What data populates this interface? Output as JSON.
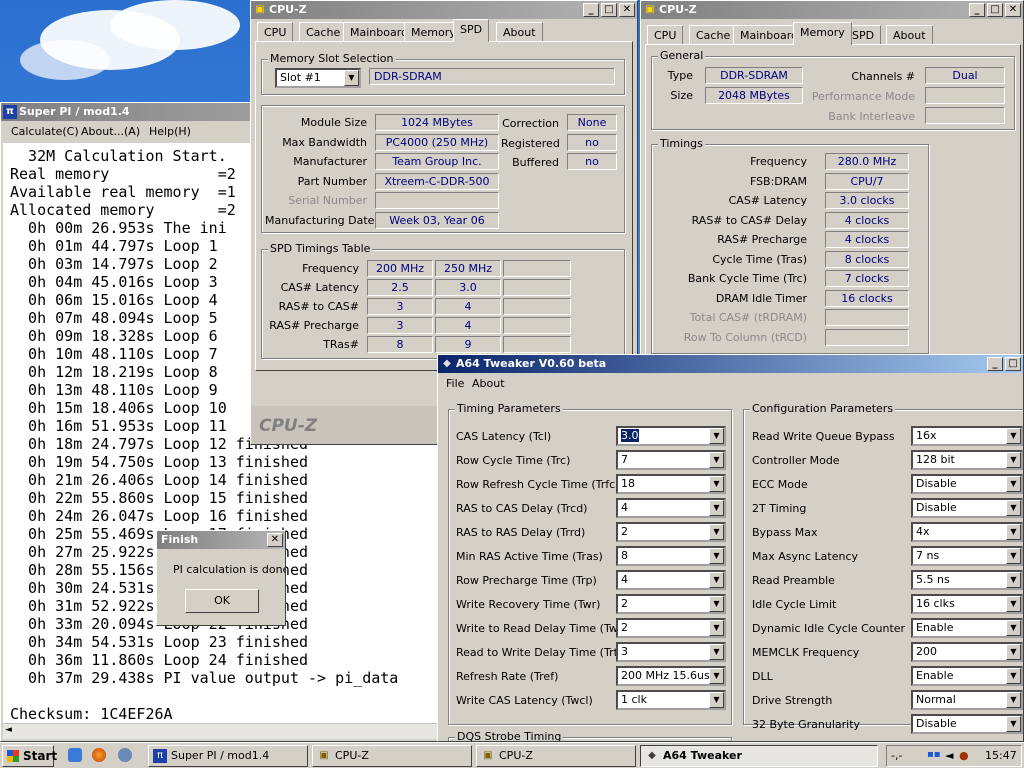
{
  "superpi": {
    "title": "Super PI / mod1.4",
    "menu": [
      "Calculate(C)",
      "About...(A)",
      "Help(H)"
    ],
    "lines": [
      "  32M Calculation Start.",
      "Real memory            =2",
      "Available real memory  =1",
      "Allocated memory       =2",
      "  0h 00m 26.953s The ini",
      "  0h 01m 44.797s Loop 1",
      "  0h 03m 14.797s Loop 2",
      "  0h 04m 45.016s Loop 3",
      "  0h 06m 15.016s Loop 4",
      "  0h 07m 48.094s Loop 5",
      "  0h 09m 18.328s Loop 6",
      "  0h 10m 48.110s Loop 7",
      "  0h 12m 18.219s Loop 8",
      "  0h 13m 48.110s Loop 9",
      "  0h 15m 18.406s Loop 10",
      "  0h 16m 51.953s Loop 11",
      "  0h 18m 24.797s Loop 12 finished",
      "  0h 19m 54.750s Loop 13 finished",
      "  0h 21m 26.406s Loop 14 finished",
      "  0h 22m 55.860s Loop 15 finished",
      "  0h 24m 26.047s Loop 16 finished",
      "  0h 25m 55.469s Loop 17 finished",
      "  0h 27m 25.922s Loop 18 finished",
      "  0h 28m 55.156s Loop 19 finished",
      "  0h 30m 24.531s Loop 20 finished",
      "  0h 31m 52.922s Loop 21 finished",
      "  0h 33m 20.094s Loop 22 finished",
      "  0h 34m 54.531s Loop 23 finished",
      "  0h 36m 11.860s Loop 24 finished",
      "  0h 37m 29.438s PI value output -> pi_data",
      "",
      "Checksum: 1C4EF26A"
    ]
  },
  "finish": {
    "title": "Finish",
    "message": "PI calculation is done!",
    "ok": "OK"
  },
  "cpuz_spd": {
    "title": "CPU-Z",
    "tabs": [
      "CPU",
      "Cache",
      "Mainboard",
      "Memory",
      "SPD",
      "About"
    ],
    "slot_group": "Memory Slot Selection",
    "slot": "Slot #1",
    "slot_type": "DDR-SDRAM",
    "rows": [
      {
        "label": "Module Size",
        "value": "1024 MBytes"
      },
      {
        "label": "Max Bandwidth",
        "value": "PC4000 (250 MHz)"
      },
      {
        "label": "Manufacturer",
        "value": "Team Group Inc."
      },
      {
        "label": "Part Number",
        "value": "Xtreem-C-DDR-500"
      },
      {
        "label": "Serial Number",
        "value": ""
      },
      {
        "label": "Manufacturing Date",
        "value": "Week 03, Year 06"
      }
    ],
    "side": [
      {
        "label": "Correction",
        "value": "None"
      },
      {
        "label": "Registered",
        "value": "no"
      },
      {
        "label": "Buffered",
        "value": "no"
      }
    ],
    "timings_group": "SPD Timings Table",
    "timing_rows": [
      {
        "label": "Frequency",
        "v1": "200 MHz",
        "v2": "250 MHz"
      },
      {
        "label": "CAS# Latency",
        "v1": "2.5",
        "v2": "3.0"
      },
      {
        "label": "RAS# to CAS#",
        "v1": "3",
        "v2": "4"
      },
      {
        "label": "RAS# Precharge",
        "v1": "3",
        "v2": "4"
      },
      {
        "label": "TRas#",
        "v1": "8",
        "v2": "9"
      }
    ],
    "brand": "CPU-Z"
  },
  "cpuz_mem": {
    "title": "CPU-Z",
    "tabs": [
      "CPU",
      "Cache",
      "Mainboard",
      "Memory",
      "SPD",
      "About"
    ],
    "general": "General",
    "type_label": "Type",
    "type": "DDR-SDRAM",
    "size_label": "Size",
    "size": "2048 MBytes",
    "channels_label": "Channels #",
    "channels": "Dual",
    "perf_label": "Performance Mode",
    "bank_label": "Bank Interleave",
    "timings": "Timings",
    "rows": [
      {
        "label": "Frequency",
        "value": "280.0 MHz"
      },
      {
        "label": "FSB:DRAM",
        "value": "CPU/7"
      },
      {
        "label": "CAS# Latency",
        "value": "3.0 clocks"
      },
      {
        "label": "RAS# to CAS# Delay",
        "value": "4 clocks"
      },
      {
        "label": "RAS# Precharge",
        "value": "4 clocks"
      },
      {
        "label": "Cycle Time (Tras)",
        "value": "8 clocks"
      },
      {
        "label": "Bank Cycle Time (Trc)",
        "value": "7 clocks"
      },
      {
        "label": "DRAM Idle Timer",
        "value": "16 clocks"
      },
      {
        "label": "Total CAS# (tRDRAM)",
        "value": ""
      },
      {
        "label": "Row To Column (tRCD)",
        "value": ""
      }
    ]
  },
  "a64": {
    "title": "A64 Tweaker V0.60 beta",
    "menu": [
      "File",
      "About"
    ],
    "timing_group": "Timing Parameters",
    "config_group": "Configuration Parameters",
    "dqs_group": "DQS Strobe Timing",
    "timing": [
      {
        "label": "CAS Latency (Tcl)",
        "value": "3.0"
      },
      {
        "label": "Row Cycle Time (Trc)",
        "value": "7"
      },
      {
        "label": "Row Refresh Cycle Time (Trfc)",
        "value": "18"
      },
      {
        "label": "RAS to CAS Delay (Trcd)",
        "value": "4"
      },
      {
        "label": "RAS to RAS Delay (Trrd)",
        "value": "2"
      },
      {
        "label": "Min RAS Active Time (Tras)",
        "value": "8"
      },
      {
        "label": "Row Precharge Time (Trp)",
        "value": "4"
      },
      {
        "label": "Write Recovery Time (Twr)",
        "value": "2"
      },
      {
        "label": "Write to Read Delay Time (Twtr)",
        "value": "2"
      },
      {
        "label": "Read to Write Delay Time (Trtw)",
        "value": "3"
      },
      {
        "label": "Refresh Rate (Tref)",
        "value": "200 MHz 15.6us"
      },
      {
        "label": "Write CAS Latency (Twcl)",
        "value": "1 clk"
      }
    ],
    "config": [
      {
        "label": "Read Write Queue Bypass",
        "value": "16x"
      },
      {
        "label": "Controller Mode",
        "value": "128 bit"
      },
      {
        "label": "ECC Mode",
        "value": "Disable"
      },
      {
        "label": "2T Timing",
        "value": "Disable"
      },
      {
        "label": "Bypass Max",
        "value": "4x"
      },
      {
        "label": "Max Async Latency",
        "value": "7 ns"
      },
      {
        "label": "Read Preamble",
        "value": "5.5 ns"
      },
      {
        "label": "Idle Cycle Limit",
        "value": "16 clks"
      },
      {
        "label": "Dynamic Idle Cycle Counter",
        "value": "Enable"
      },
      {
        "label": "MEMCLK Frequency",
        "value": "200"
      },
      {
        "label": "DLL",
        "value": "Enable"
      },
      {
        "label": "Drive Strength",
        "value": "Normal"
      },
      {
        "label": "32 Byte Granularity",
        "value": "Disable"
      }
    ]
  },
  "taskbar": {
    "start": "Start",
    "items": [
      {
        "label": "Super PI / mod1.4"
      },
      {
        "label": "CPU-Z"
      },
      {
        "label": "CPU-Z"
      },
      {
        "label": "A64 Tweaker"
      }
    ],
    "tray_text": "-,-",
    "clock": "15:47"
  }
}
